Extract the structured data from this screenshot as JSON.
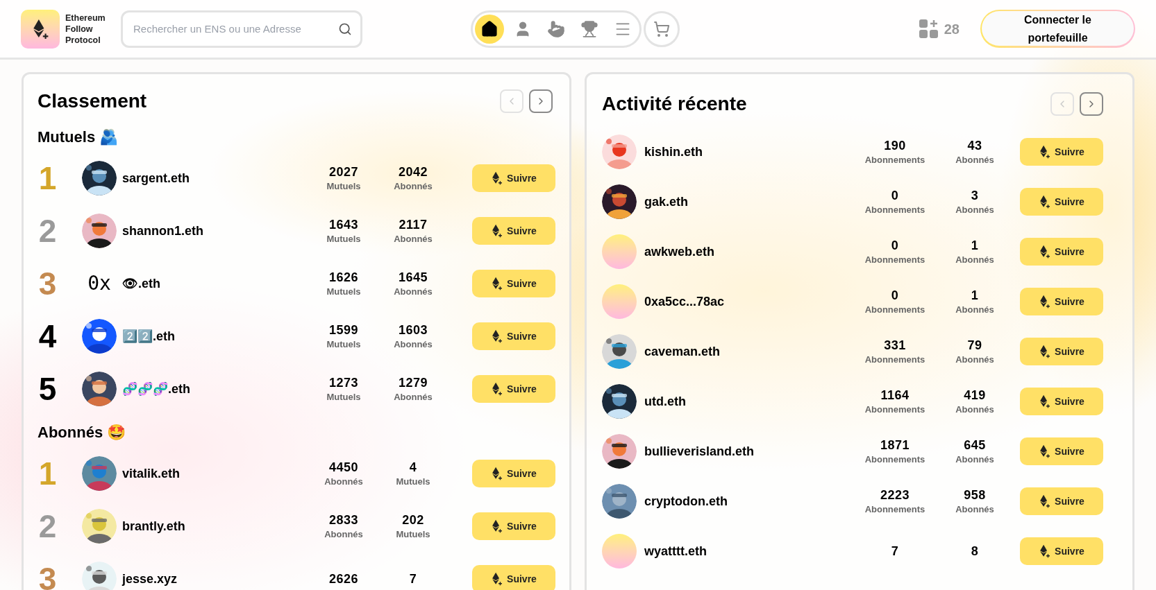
{
  "brand": {
    "name": "Ethereum Follow Protocol"
  },
  "search": {
    "placeholder": "Rechercher un ENS ou une Adresse"
  },
  "nav": [
    {
      "kind": "home",
      "selected": true
    },
    {
      "kind": "profile",
      "selected": false
    },
    {
      "kind": "swipe",
      "selected": false
    },
    {
      "kind": "trophy",
      "selected": false
    },
    {
      "kind": "menu",
      "selected": false
    }
  ],
  "cart": {
    "kind": "cart"
  },
  "list_count": "28",
  "connect_button": "Connecter le portefeuille",
  "leaderboard": {
    "title": "Classement",
    "prev_disabled": true,
    "next_disabled": false,
    "sections": [
      {
        "heading": "Mutuels 🫂",
        "rows": [
          {
            "rank": "1",
            "color": "#d4a62a",
            "avatar": {
              "kind": "picture"
            },
            "name": "sargent.eth",
            "stats": [
              {
                "value": "2027",
                "label": "Mutuels"
              },
              {
                "value": "2042",
                "label": "Abonnés"
              }
            ],
            "button": "Suivre"
          },
          {
            "rank": "2",
            "color": "#9a9a9a",
            "avatar": {
              "kind": "picture"
            },
            "name": "shannon1.eth",
            "stats": [
              {
                "value": "1643",
                "label": "Mutuels"
              },
              {
                "value": "2117",
                "label": "Abonnés"
              }
            ],
            "button": "Suivre"
          },
          {
            "rank": "3",
            "color": "#c48a50",
            "avatar": {
              "kind": "text",
              "text": "0x"
            },
            "name": "👁.eth",
            "stats": [
              {
                "value": "1626",
                "label": "Mutuels"
              },
              {
                "value": "1645",
                "label": "Abonnés"
              }
            ],
            "button": "Suivre"
          },
          {
            "rank": "4",
            "color": "#000000",
            "avatar": {
              "kind": "picture"
            },
            "name": "2️⃣2️⃣.eth",
            "stats": [
              {
                "value": "1599",
                "label": "Mutuels"
              },
              {
                "value": "1603",
                "label": "Abonnés"
              }
            ],
            "button": "Suivre"
          },
          {
            "rank": "5",
            "color": "#000000",
            "avatar": {
              "kind": "picture"
            },
            "name": "🧬🧬🧬.eth",
            "stats": [
              {
                "value": "1273",
                "label": "Mutuels"
              },
              {
                "value": "1279",
                "label": "Abonnés"
              }
            ],
            "button": "Suivre"
          }
        ]
      },
      {
        "heading": "Abonnés 🤩",
        "rows": [
          {
            "rank": "1",
            "color": "#d4a62a",
            "avatar": {
              "kind": "picture"
            },
            "name": "vitalik.eth",
            "stats": [
              {
                "value": "4450",
                "label": "Abonnés"
              },
              {
                "value": "4",
                "label": "Mutuels"
              }
            ],
            "button": "Suivre"
          },
          {
            "rank": "2",
            "color": "#9a9a9a",
            "avatar": {
              "kind": "picture"
            },
            "name": "brantly.eth",
            "stats": [
              {
                "value": "2833",
                "label": "Abonnés"
              },
              {
                "value": "202",
                "label": "Mutuels"
              }
            ],
            "button": "Suivre"
          },
          {
            "rank": "3",
            "color": "#c48a50",
            "avatar": {
              "kind": "picture"
            },
            "name": "jesse.xyz",
            "stats": [
              {
                "value": "2626"
              },
              {
                "value": "7"
              }
            ],
            "button": "Suivre"
          }
        ]
      }
    ]
  },
  "activity": {
    "title": "Activité récente",
    "prev_disabled": true,
    "next_disabled": false,
    "rows": [
      {
        "avatar": {
          "kind": "picture"
        },
        "name": "kishin.eth",
        "stats": [
          {
            "value": "190",
            "label": "Abonnements"
          },
          {
            "value": "43",
            "label": "Abonnés"
          }
        ],
        "button": "Suivre"
      },
      {
        "avatar": {
          "kind": "picture"
        },
        "name": "gak.eth",
        "stats": [
          {
            "value": "0",
            "label": "Abonnements"
          },
          {
            "value": "3",
            "label": "Abonnés"
          }
        ],
        "button": "Suivre"
      },
      {
        "avatar": {
          "kind": "gradient"
        },
        "name": "awkweb.eth",
        "stats": [
          {
            "value": "0",
            "label": "Abonnements"
          },
          {
            "value": "1",
            "label": "Abonnés"
          }
        ],
        "button": "Suivre"
      },
      {
        "avatar": {
          "kind": "gradient"
        },
        "name": "0xa5cc...78ac",
        "stats": [
          {
            "value": "0",
            "label": "Abonnements"
          },
          {
            "value": "1",
            "label": "Abonnés"
          }
        ],
        "button": "Suivre"
      },
      {
        "avatar": {
          "kind": "picture"
        },
        "name": "caveman.eth",
        "stats": [
          {
            "value": "331",
            "label": "Abonnements"
          },
          {
            "value": "79",
            "label": "Abonnés"
          }
        ],
        "button": "Suivre"
      },
      {
        "avatar": {
          "kind": "picture"
        },
        "name": "utd.eth",
        "stats": [
          {
            "value": "1164",
            "label": "Abonnements"
          },
          {
            "value": "419",
            "label": "Abonnés"
          }
        ],
        "button": "Suivre"
      },
      {
        "avatar": {
          "kind": "picture"
        },
        "name": "bullieverisland.eth",
        "stats": [
          {
            "value": "1871",
            "label": "Abonnements"
          },
          {
            "value": "645",
            "label": "Abonnés"
          }
        ],
        "button": "Suivre"
      },
      {
        "avatar": {
          "kind": "picture"
        },
        "name": "cryptodon.eth",
        "stats": [
          {
            "value": "2223",
            "label": "Abonnements"
          },
          {
            "value": "958",
            "label": "Abonnés"
          }
        ],
        "button": "Suivre"
      },
      {
        "avatar": {
          "kind": "gradient"
        },
        "name": "wyatttt.eth",
        "stats": [
          {
            "value": "7"
          },
          {
            "value": "8"
          }
        ],
        "button": "Suivre"
      }
    ]
  }
}
